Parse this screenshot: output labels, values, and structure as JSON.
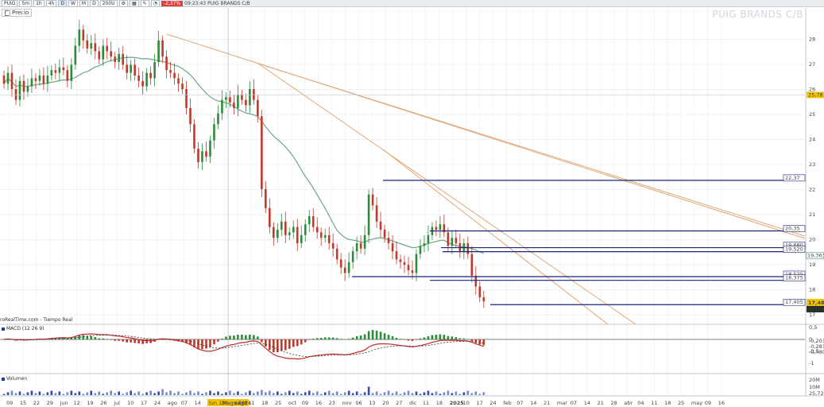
{
  "toolbar": {
    "symbol": "PUIG",
    "timeframes": [
      "5m",
      "1h",
      "4h",
      "D",
      "W",
      "M"
    ],
    "chart_type": "D",
    "bars": "200U",
    "change": "-2,37%",
    "time": "09:23:43",
    "name": "PUIG BRANDS C/B"
  },
  "panel": {
    "price_label": "Precio",
    "watermark": "PUIG BRANDS C/B",
    "source": "roRealTime.com - Tiempo Real",
    "macd_label": "MACD (12 26 9)",
    "volume_label": "Volumen",
    "cursor_date": "lun 19 ago 2024"
  },
  "colors": {
    "up": "#2e8b3a",
    "down": "#c0392b",
    "level": "#1a237e",
    "trend": "#e0a878",
    "ma": "#6aa884",
    "macd": "#c62828",
    "signal": "#333333",
    "tag_current": "#f5c400"
  },
  "chart_data": [
    {
      "type": "candlestick",
      "title": "PUIG BRANDS C/B",
      "x_date_labels": [
        "09",
        "15",
        "22",
        "29",
        "jun",
        "12",
        "19",
        "26",
        "jul",
        "10",
        "17",
        "24",
        "ago",
        "07",
        "14",
        "",
        "28",
        "sept",
        "11",
        "18",
        "25",
        "oct",
        "09",
        "16",
        "23",
        "nov",
        "06",
        "13",
        "20",
        "27",
        "dic",
        "11",
        "18",
        "2025",
        "10",
        "17",
        "24",
        "feb",
        "07",
        "14",
        "21",
        "mar",
        "07",
        "14",
        "21",
        "28",
        "abr",
        "04",
        "11",
        "18",
        "25",
        "may",
        "09",
        "16"
      ],
      "y_ticks": [
        28,
        27,
        26,
        25,
        24,
        23,
        22,
        21,
        20,
        19,
        18,
        17
      ],
      "ylim": [
        16.6,
        28.3
      ],
      "price_levels": [
        22.37,
        20.35,
        19.68,
        19.52,
        18.525,
        18.375,
        17.405
      ],
      "price_level_labels": [
        "22,37",
        "20,35",
        "19,680",
        "19,520",
        "18,525",
        "18,375",
        "17,405"
      ],
      "right_tags": {
        "last_close": "25,78",
        "ma_value": "19,363",
        "current": "17,48",
        "countdown": "6h10m"
      },
      "closes": [
        25.5,
        25.9,
        25.3,
        24.9,
        25.6,
        25.2,
        25.4,
        25.7,
        25.6,
        25.8,
        25.5,
        25.8,
        26.0,
        25.9,
        26.1,
        26.0,
        25.6,
        26.2,
        26.9,
        27.5,
        27.1,
        26.8,
        27.0,
        26.7,
        26.4,
        26.9,
        26.7,
        26.5,
        26.3,
        26.6,
        26.2,
        25.9,
        26.2,
        25.8,
        25.6,
        25.4,
        25.9,
        25.7,
        26.3,
        27.1,
        26.5,
        26.0,
        25.9,
        25.7,
        25.5,
        25.3,
        24.6,
        24.0,
        23.1,
        22.6,
        23.0,
        22.8,
        23.4,
        24.0,
        24.4,
        24.9,
        25.0,
        24.8,
        24.6,
        25.1,
        24.9,
        24.7,
        25.3,
        24.9,
        24.3,
        21.6,
        20.9,
        20.2,
        19.8,
        20.1,
        20.4,
        19.9,
        20.0,
        20.2,
        19.6,
        19.9,
        20.3,
        20.6,
        20.2,
        20.0,
        19.8,
        19.9,
        19.6,
        19.4,
        19.0,
        18.7,
        18.5,
        18.9,
        19.3,
        19.6,
        19.4,
        19.9,
        21.4,
        21.0,
        20.4,
        20.1,
        19.8,
        19.6,
        19.3,
        19.0,
        18.9,
        18.8,
        18.6,
        18.5,
        19.2,
        19.5,
        19.6,
        19.9,
        20.2,
        20.1,
        20.3,
        20.0,
        19.5,
        19.8,
        19.6,
        19.3,
        19.6,
        19.2,
        18.4,
        18.0,
        17.6,
        17.45
      ]
    },
    {
      "type": "bar",
      "title": "MACD (12 26 9)",
      "y_ticks": [
        "0,5",
        "0",
        "-0,5",
        "-1"
      ],
      "value_labels": [
        "-0,201",
        "-0,281",
        "-0,480"
      ]
    },
    {
      "type": "bar",
      "title": "Volumen",
      "y_ticks": [
        "20M",
        "10M",
        "25,726"
      ]
    }
  ]
}
